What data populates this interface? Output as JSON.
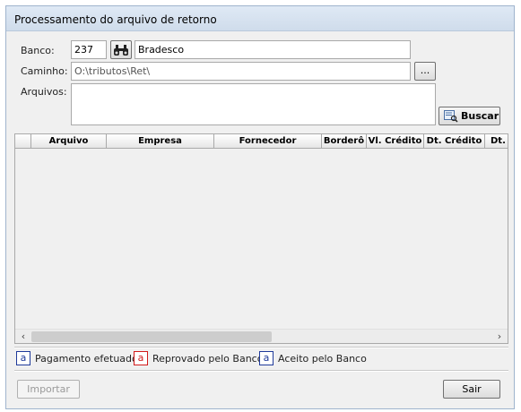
{
  "window": {
    "title": "Processamento do arquivo de retorno"
  },
  "form": {
    "banco_label": "Banco:",
    "banco_code": "237",
    "banco_name": "Bradesco",
    "caminho_label": "Caminho:",
    "caminho_value": "O:\\tributos\\Ret\\",
    "browse_label": "...",
    "arquivos_label": "Arquivos:",
    "buscar_label": "Buscar"
  },
  "grid": {
    "columns": [
      "Arquivo",
      "Empresa",
      "Fornecedor",
      "Borderô",
      "Vl. Crédito",
      "Dt. Crédito",
      "Dt. De"
    ]
  },
  "legend": [
    {
      "marker": "a",
      "label": "Pagamento efetuado",
      "color": "#1f3a9a"
    },
    {
      "marker": "a",
      "label": "Reprovado pelo Banco",
      "color": "#d11a1a"
    },
    {
      "marker": "a",
      "label": "Aceito pelo Banco",
      "color": "#1f3a9a"
    }
  ],
  "footer": {
    "importar_label": "Importar",
    "sair_label": "Sair"
  }
}
